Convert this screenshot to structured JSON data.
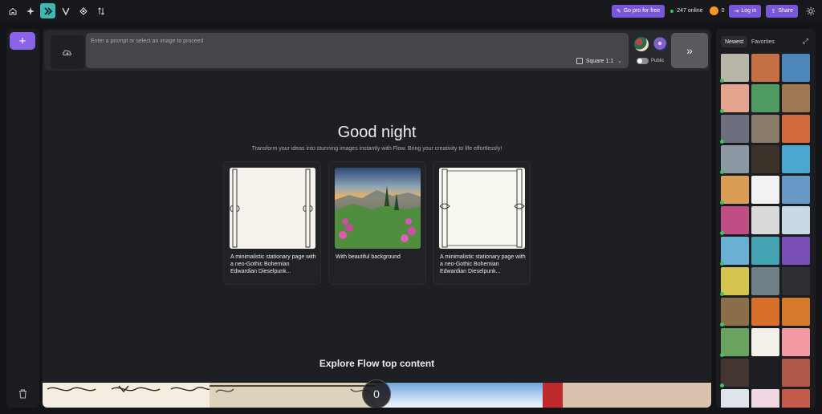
{
  "topbar": {
    "go_pro_label": "Go pro for free",
    "online_text": "247 online",
    "credits": "0",
    "login_label": "Log in",
    "share_label": "Share"
  },
  "prompt": {
    "placeholder": "Enter a prompt or select an image to proceed",
    "ratio_label": "Square 1:1",
    "public_label": "Public"
  },
  "main": {
    "greeting": "Good night",
    "subtitle": "Transform your ideas into stunning images instantly with Flow. Bring your creativity to life effortlessly!",
    "cards": [
      {
        "caption": "A minimalistic stationary page with a neo-Gothic Bohemian Edwardian Dieselpunk..."
      },
      {
        "caption": "With beautiful background"
      },
      {
        "caption": "A minimalistic stationary page with a neo-Gothic Bohemian Edwardian Dieselpunk..."
      }
    ],
    "explore_title": "Explore Flow top content",
    "scroll_value": "0"
  },
  "right_panel": {
    "tabs": [
      "Newest",
      "Favorites"
    ],
    "thumb_colors": [
      "#b8b6a9",
      "#c56f45",
      "#4d86b8",
      "#e3a58e",
      "#4f9a62",
      "#9f7754",
      "#6b6f7e",
      "#8a7a6a",
      "#d46a3b",
      "#8c98a4",
      "#3a3128",
      "#4aa7cf",
      "#d89c55",
      "#f2f2f2",
      "#6699c5",
      "#bf4d86",
      "#d9d9d9",
      "#c9d9e6",
      "#6ab0d5",
      "#44a3b2",
      "#7a4fb5",
      "#d3c54f",
      "#6f7f87",
      "#2f3033",
      "#8b6d4a",
      "#d86f2a",
      "#d57a2a",
      "#6aa25f",
      "#f4efe9",
      "#f39aa2",
      "#43352f",
      "#1d1e21",
      "#b0584a",
      "#dfe3ea",
      "#f0d6e0",
      "#c35a4a"
    ]
  }
}
